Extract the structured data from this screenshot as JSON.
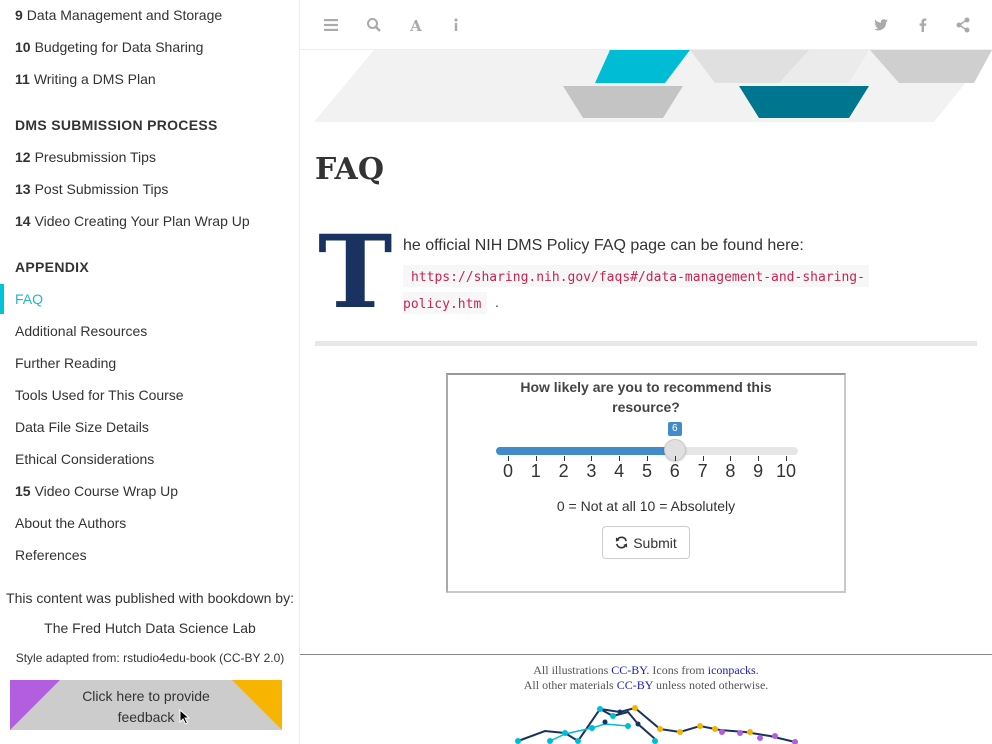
{
  "sidebar": {
    "items_top": [
      {
        "num": "9",
        "label": "Data Management and Storage"
      },
      {
        "num": "10",
        "label": "Budgeting for Data Sharing"
      },
      {
        "num": "11",
        "label": "Writing a DMS Plan"
      }
    ],
    "section_submission": "DMS SUBMISSION PROCESS",
    "items_submission": [
      {
        "num": "12",
        "label": "Presubmission Tips"
      },
      {
        "num": "13",
        "label": "Post Submission Tips"
      },
      {
        "num": "14",
        "label": "Video Creating Your Plan Wrap Up"
      }
    ],
    "section_appendix": "APPENDIX",
    "items_appendix": [
      {
        "num": "",
        "label": "FAQ"
      },
      {
        "num": "",
        "label": "Additional Resources"
      },
      {
        "num": "",
        "label": "Further Reading"
      },
      {
        "num": "",
        "label": "Tools Used for This Course"
      },
      {
        "num": "",
        "label": "Data File Size Details"
      },
      {
        "num": "",
        "label": "Ethical Considerations"
      },
      {
        "num": "15",
        "label": "Video Course Wrap Up"
      },
      {
        "num": "",
        "label": "About the Authors"
      },
      {
        "num": "",
        "label": "References"
      }
    ],
    "published_by": "This content was published with bookdown by:",
    "fred_hutch": "The Fred Hutch Data Science Lab",
    "style_adapted": "Style adapted from: rstudio4edu-book (CC-BY 2.0)",
    "feedback": "Click here to provide feedback"
  },
  "toolbar": {
    "left_icons": [
      "sidebar-toggle-icon",
      "search-icon",
      "font-settings-icon",
      "info-icon"
    ],
    "right_icons": [
      "twitter-icon",
      "facebook-icon",
      "share-icon"
    ]
  },
  "content": {
    "title": "FAQ",
    "dropcap": "T",
    "para_text": "he official NIH DMS Policy FAQ page can be found here:",
    "url_part1": "https://sharing.nih.gov/faqs#/data-management-and-sharing-",
    "url_part2": "policy.htm",
    "url_suffix": "."
  },
  "survey": {
    "question": "How likely are you to recommend this resource?",
    "value": 6,
    "min": 0,
    "max": 10,
    "ticks": [
      "0",
      "1",
      "2",
      "3",
      "4",
      "5",
      "6",
      "7",
      "8",
      "9",
      "10"
    ],
    "scale_note": "0 = Not at all 10 = Absolutely",
    "submit_label": "Submit"
  },
  "footer": {
    "line1_prefix": "All illustrations ",
    "line1_link1": "CC-BY.",
    "line1_mid": " Icons from ",
    "line1_link2": "iconpacks",
    "line1_suffix": ".",
    "line2_prefix": "All other materials ",
    "line2_link": "CC-BY",
    "line2_suffix": " unless noted otherwise."
  },
  "colors": {
    "accent": "#00c5d9",
    "dropcap": "#1a3260",
    "slider": "#428bca",
    "feedback_left": "#b35ee0",
    "feedback_right": "#f7b500"
  }
}
